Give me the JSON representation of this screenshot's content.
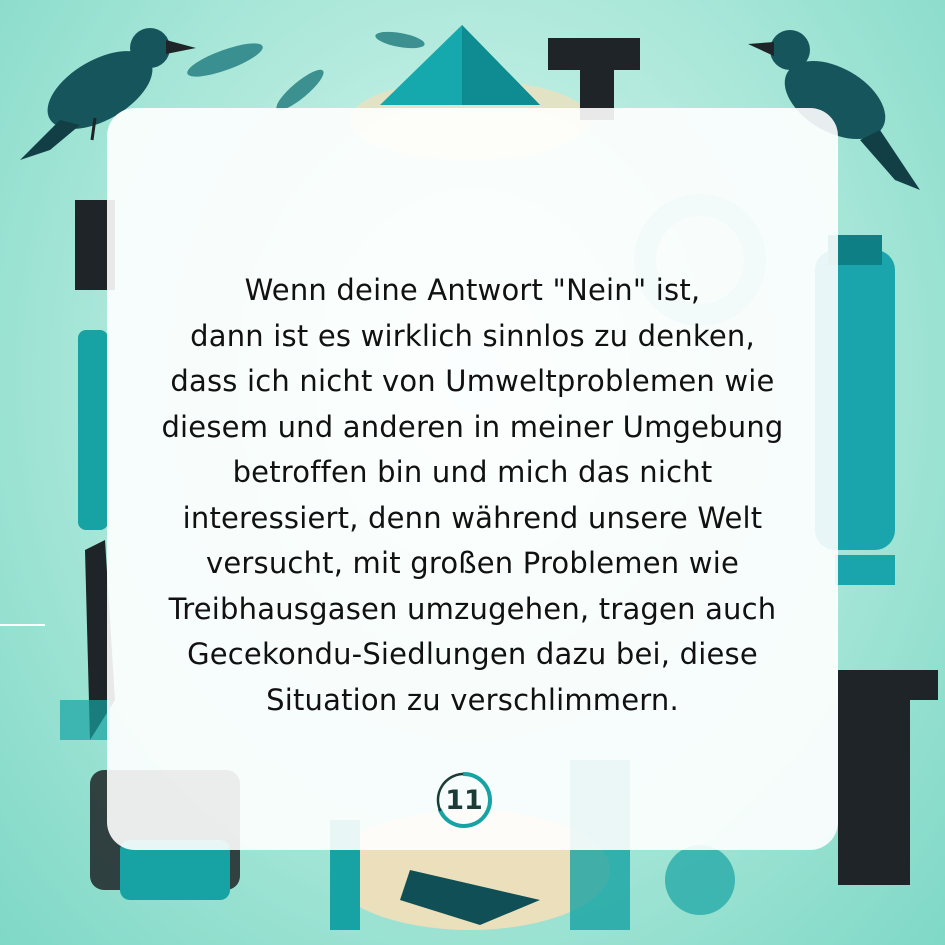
{
  "quote": {
    "lines": [
      "Wenn deine Antwort \"Nein\" ist,",
      "dann ist es wirklich sinnlos zu denken,",
      "dass ich nicht von Umweltproblemen wie",
      "diesem und anderen in meiner Umgebung",
      "betroffen bin und mich das nicht",
      "interessiert, denn während unsere Welt",
      "versucht, mit großen Problemen wie",
      "Treibhausgasen umzugehen, tragen auch",
      "Gecekondu-Siedlungen dazu bei, diese",
      "Situation zu verschlimmern."
    ]
  },
  "page": {
    "number": "11"
  },
  "background": {
    "description_icons": [
      "crow-icon",
      "crow-icon",
      "gear-icon",
      "bottle-icon",
      "pyramid-icon",
      "letter-t-icon",
      "leaf-icon",
      "bracket-icon"
    ],
    "colors": {
      "mint": "#b5ece0",
      "teal": "#17a3a3",
      "dark_teal": "#0f4f55",
      "black": "#1e2427",
      "sand": "#f3dfb8"
    }
  }
}
